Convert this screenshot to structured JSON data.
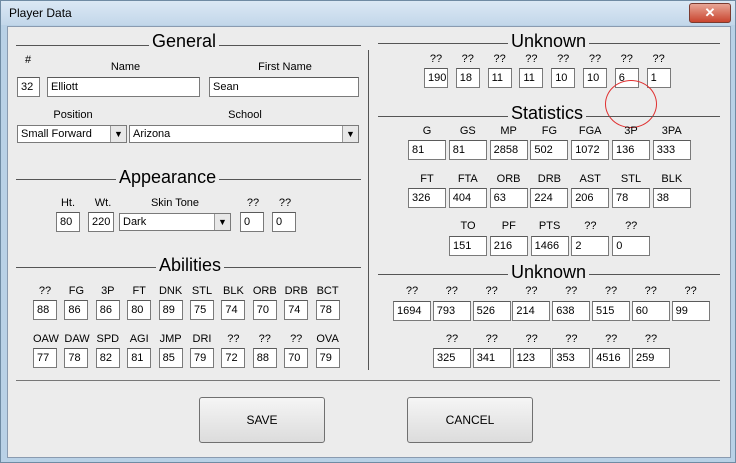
{
  "window": {
    "title": "Player Data",
    "close_label": "✕"
  },
  "general": {
    "heading": "General",
    "num_label": "#",
    "num": "32",
    "name_label": "Name",
    "name": "Elliott",
    "first_name_label": "First Name",
    "first_name": "Sean",
    "position_label": "Position",
    "position": "Small Forward",
    "school_label": "School",
    "school": "Arizona"
  },
  "appearance": {
    "heading": "Appearance",
    "ht_label": "Ht.",
    "ht": "80",
    "wt_label": "Wt.",
    "wt": "220",
    "skin_label": "Skin Tone",
    "skin": "Dark",
    "u1_label": "??",
    "u1": "0",
    "u2_label": "??",
    "u2": "0"
  },
  "abilities": {
    "heading": "Abilities",
    "row1_labels": [
      "??",
      "FG",
      "3P",
      "FT",
      "DNK",
      "STL",
      "BLK",
      "ORB",
      "DRB",
      "BCT"
    ],
    "row1_values": [
      "88",
      "86",
      "86",
      "80",
      "89",
      "75",
      "74",
      "70",
      "74",
      "78"
    ],
    "row2_labels": [
      "OAW",
      "DAW",
      "SPD",
      "AGI",
      "JMP",
      "DRI",
      "??",
      "??",
      "??",
      "OVA"
    ],
    "row2_values": [
      "77",
      "78",
      "82",
      "81",
      "85",
      "79",
      "72",
      "88",
      "70",
      "79"
    ]
  },
  "unknown1": {
    "heading": "Unknown",
    "labels": [
      "??",
      "??",
      "??",
      "??",
      "??",
      "??",
      "??",
      "??"
    ],
    "values": [
      "190",
      "18",
      "11",
      "11",
      "10",
      "10",
      "6",
      "1"
    ]
  },
  "statistics": {
    "heading": "Statistics",
    "row1_labels": [
      "G",
      "GS",
      "MP",
      "FG",
      "FGA",
      "3P",
      "3PA"
    ],
    "row1_values": [
      "81",
      "81",
      "2858",
      "502",
      "1072",
      "136",
      "333"
    ],
    "row2_labels": [
      "FT",
      "FTA",
      "ORB",
      "DRB",
      "AST",
      "STL",
      "BLK"
    ],
    "row2_values": [
      "326",
      "404",
      "63",
      "224",
      "206",
      "78",
      "38"
    ],
    "row3_labels": [
      "TO",
      "PF",
      "PTS",
      "??",
      "??"
    ],
    "row3_values": [
      "151",
      "216",
      "1466",
      "2",
      "0"
    ]
  },
  "unknown2": {
    "heading": "Unknown",
    "row1_labels": [
      "??",
      "??",
      "??",
      "??",
      "??",
      "??",
      "??",
      "??"
    ],
    "row1_values": [
      "1694",
      "793",
      "526",
      "214",
      "638",
      "515",
      "60",
      "99"
    ],
    "row2_labels": [
      "??",
      "??",
      "??",
      "??",
      "??",
      "??"
    ],
    "row2_values": [
      "325",
      "341",
      "123",
      "353",
      "4516",
      "259"
    ]
  },
  "buttons": {
    "save": "SAVE",
    "cancel": "CANCEL"
  }
}
